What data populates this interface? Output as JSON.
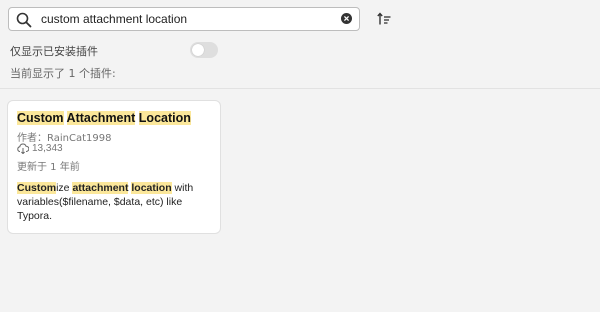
{
  "search": {
    "value": "custom attachment location",
    "placeholder": ""
  },
  "icons": {
    "search": "search-icon",
    "clear": "clear-icon",
    "sort": "sort-icon",
    "download": "download-icon"
  },
  "filter": {
    "installed_only_label": "仅显示已安装插件",
    "installed_only_enabled": false
  },
  "results": {
    "count_label": "当前显示了 1 个插件:"
  },
  "plugins": [
    {
      "title_parts": [
        "Custom",
        "Attachment",
        "Location"
      ],
      "author": "作者：RainCat1998",
      "downloads": "13,343",
      "updated": "更新于 1 年前",
      "description": {
        "custom_hl": "Custom",
        "custom_rest": "ize ",
        "attachment_hl": "attachment",
        "location_hl": "location",
        "tail": " with variables($filename, $data, etc) like Typora."
      }
    }
  ],
  "colors": {
    "highlight": "#fbe79a",
    "background": "#f3f3f3",
    "toggle_off": "#dedede"
  }
}
